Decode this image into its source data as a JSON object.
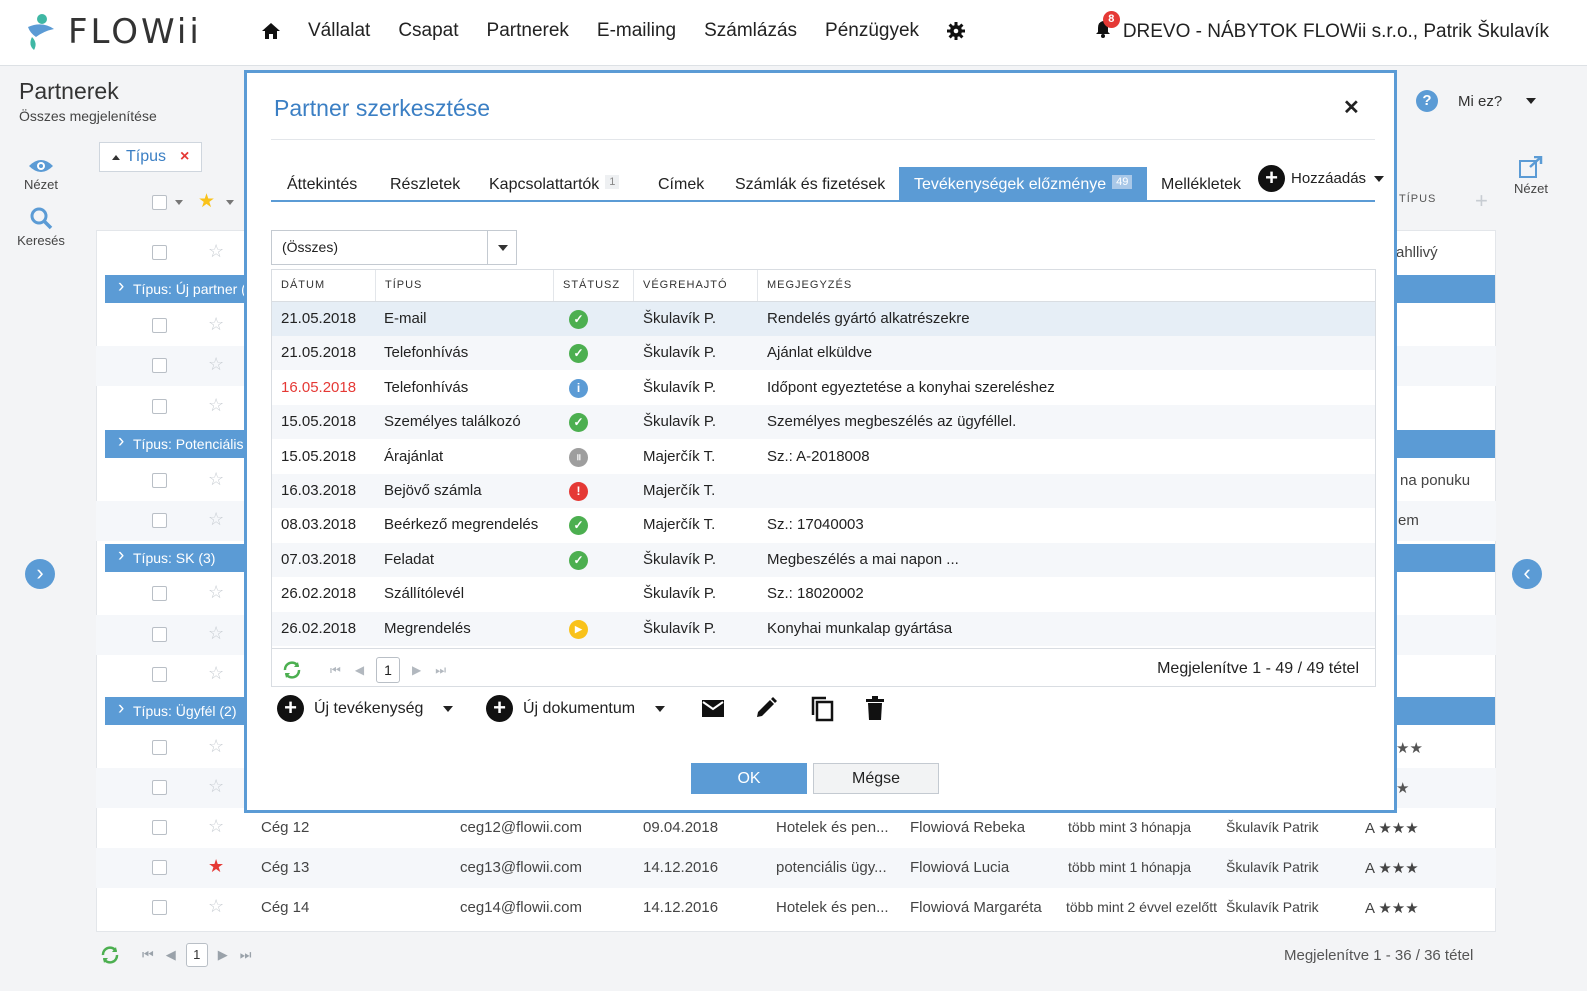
{
  "app": {
    "name": "FLOWii"
  },
  "nav": [
    "Vállalat",
    "Csapat",
    "Partnerek",
    "E-mailing",
    "Számlázás",
    "Pénzügyek"
  ],
  "user": {
    "notifications": "8",
    "label": "DREVO - NÁBYTOK FLOWii s.r.o., Patrik Škulavík"
  },
  "page": {
    "title": "Partnerek",
    "subtitle": "Összes megjelenítése"
  },
  "leftbar": {
    "view": "Nézet",
    "search": "Keresés"
  },
  "rightbar": {
    "view": "Nézet"
  },
  "help": {
    "label": "Mi ez?"
  },
  "background": {
    "filter_chip": "Típus",
    "header_type": "TÍPUS",
    "groups": [
      "Típus: Új partner (",
      "Típus: Potenciális (",
      "Típus: SK (3)",
      "Típus: Ügyfél (2)"
    ],
    "peek": [
      "ahllivý",
      "na ponuku",
      "em",
      "★★",
      "★"
    ],
    "rows": [
      {
        "name": "Cég 12",
        "email": "ceg12@flowii.com",
        "date": "09.04.2018",
        "category": "Hotelek és pen...",
        "contact": "Flowiová Rebeka",
        "last": "több mint 3 hónapja",
        "owner": "Škulavík Patrik",
        "rating": "A ★★★"
      },
      {
        "name": "Cég 13",
        "email": "ceg13@flowii.com",
        "date": "14.12.2016",
        "category": "potenciális ügy...",
        "contact": "Flowiová Lucia",
        "last": "több mint 1 hónapja",
        "owner": "Škulavík Patrik",
        "rating": "A ★★★"
      },
      {
        "name": "Cég 14",
        "email": "ceg14@flowii.com",
        "date": "14.12.2016",
        "category": "Hotelek és pen...",
        "contact": "Flowiová Margaréta",
        "last": "több mint 2 évvel ezelőtt",
        "owner": "Škulavík Patrik",
        "rating": "A ★★★"
      }
    ],
    "pager": {
      "page": "1",
      "total": "Megjelenítve 1 - 36 / 36 tétel"
    }
  },
  "modal": {
    "title": "Partner szerkesztése",
    "tabs": [
      {
        "label": "Áttekintés"
      },
      {
        "label": "Részletek"
      },
      {
        "label": "Kapcsolattartók",
        "badge": "1"
      },
      {
        "label": "Címek"
      },
      {
        "label": "Számlák és fizetések"
      },
      {
        "label": "Tevékenységek előzménye",
        "badge": "49"
      },
      {
        "label": "Mellékletek"
      }
    ],
    "add_label": "Hozzáadás",
    "filter_value": "(Összes)",
    "columns": [
      "DÁTUM",
      "TÍPUS",
      "STÁTUSZ",
      "VÉGREHAJTÓ",
      "MEGJEGYZÉS"
    ],
    "rows": [
      {
        "date": "21.05.2018",
        "type": "E-mail",
        "status": "done",
        "executor": "Škulavík P.",
        "note": "Rendelés gyártó alkatrészekre"
      },
      {
        "date": "21.05.2018",
        "type": "Telefonhívás",
        "status": "done",
        "executor": "Škulavík P.",
        "note": "Ajánlat elküldve"
      },
      {
        "date": "16.05.2018",
        "type": "Telefonhívás",
        "status": "info",
        "executor": "Škulavík P.",
        "note": "Időpont egyeztetése a konyhai szereléshez"
      },
      {
        "date": "15.05.2018",
        "type": "Személyes találkozó",
        "status": "done",
        "executor": "Škulavík P.",
        "note": "Személyes megbeszélés az ügyféllel."
      },
      {
        "date": "15.05.2018",
        "type": "Árajánlat",
        "status": "paused",
        "executor": "Majerčík T.",
        "note": "Sz.: A-2018008"
      },
      {
        "date": "16.03.2018",
        "type": "Bejövő számla",
        "status": "alert",
        "executor": "Majerčík T.",
        "note": ""
      },
      {
        "date": "08.03.2018",
        "type": "Beérkező megrendelés",
        "status": "done",
        "executor": "Majerčík T.",
        "note": "Sz.: 17040003"
      },
      {
        "date": "07.03.2018",
        "type": "Feladat",
        "status": "done",
        "executor": "Škulavík P.",
        "note": "Megbeszélés a mai napon ..."
      },
      {
        "date": "26.02.2018",
        "type": "Szállítólevél",
        "status": "none",
        "executor": "Škulavík P.",
        "note": "Sz.: 18020002"
      },
      {
        "date": "26.02.2018",
        "type": "Megrendelés",
        "status": "inprogress",
        "executor": "Škulavík P.",
        "note": "Konyhai munkalap gyártása"
      }
    ],
    "pager": {
      "page": "1",
      "total": "Megjelenítve 1 - 49 / 49 tétel"
    },
    "new_activity": "Új tevékenység",
    "new_document": "Új dokumentum",
    "ok": "OK",
    "cancel": "Mégse"
  },
  "colors": {
    "accent": "#5b9bd5",
    "done": "#4caf50",
    "info": "#5b9bd5",
    "paused": "#9e9e9e",
    "alert": "#e53935",
    "inprogress": "#f9c21a"
  }
}
